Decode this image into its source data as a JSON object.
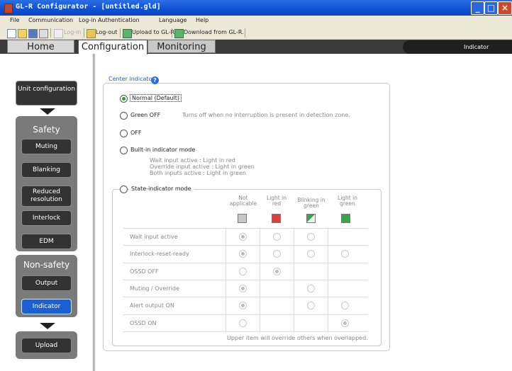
{
  "window": {
    "title": "GL-R Configurator - [untitled.gld]"
  },
  "menu": {
    "items": [
      "File",
      "Communication",
      "Log-in Authentication",
      "Language",
      "Help"
    ]
  },
  "toolbar": {
    "login": "Log-in",
    "logout": "Log-out",
    "upload": "Upload to GL-R.",
    "download": "Download from GL-R."
  },
  "tabs": {
    "home": "Home",
    "configuration": "Configuration",
    "monitoring": "Monitoring",
    "current_page": "Indicator"
  },
  "sidebar": {
    "unit_config": "Unit configuration",
    "safety_title": "Safety",
    "safety_items": [
      "Muting",
      "Blanking",
      "Reduced resolution",
      "Interlock",
      "EDM"
    ],
    "nonsafety_title": "Non-safety",
    "nonsafety_items": [
      "Output",
      "Indicator"
    ],
    "upload": "Upload"
  },
  "center_indicator": {
    "legend": "Center indicator",
    "selected": "Normal (Default)",
    "options": {
      "normal": "Normal (Default)",
      "green_off": "Green OFF",
      "green_off_desc": "Turns off when no interruption is present in detection zone.",
      "off": "OFF",
      "builtin": "Built-in indicator mode",
      "builtin_desc": [
        "Wait input active : Light in red",
        "Override input active : Light in green",
        "Both inputs active : Light in green"
      ],
      "state": "State-indicator mode"
    },
    "table": {
      "columns": [
        {
          "label": "Not applicable",
          "color": "#c8c8c8"
        },
        {
          "label": "Light in red",
          "color": "#e03c3c"
        },
        {
          "label": "Blinking in green",
          "color": "#3aa64a"
        },
        {
          "label": "Light in green",
          "color": "#3aa64a"
        }
      ],
      "rows": [
        {
          "label": "Wait input active",
          "cells": [
            "selected",
            "option",
            "option",
            ""
          ]
        },
        {
          "label": "Interlock-reset-ready",
          "cells": [
            "selected",
            "option",
            "option",
            "option"
          ]
        },
        {
          "label": "OSSD OFF",
          "cells": [
            "option",
            "selected",
            "",
            ""
          ]
        },
        {
          "label": "Muting / Override",
          "cells": [
            "selected",
            "",
            "option",
            ""
          ]
        },
        {
          "label": "Alert output ON",
          "cells": [
            "selected",
            "",
            "option",
            "option"
          ]
        },
        {
          "label": "OSSD ON",
          "cells": [
            "option",
            "",
            "",
            "selected"
          ]
        }
      ],
      "footnote": "Upper item will override others when overlapped."
    }
  }
}
